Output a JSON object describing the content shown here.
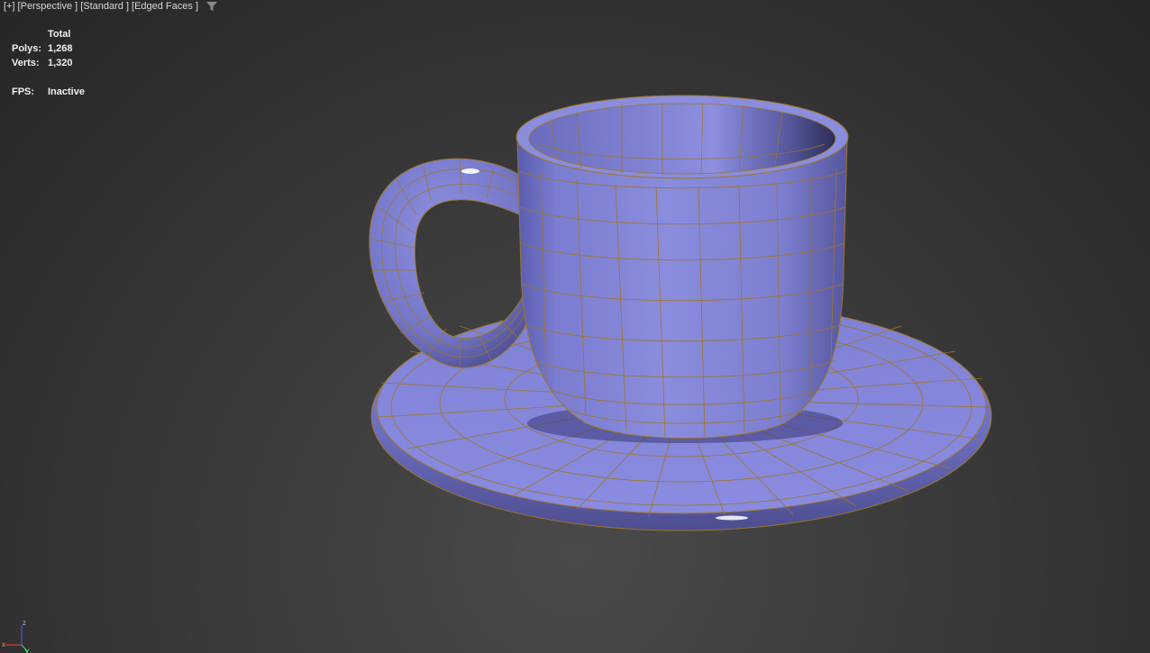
{
  "viewport": {
    "labels": [
      "[+]",
      "[Perspective ]",
      "[Standard ]",
      "[Edged Faces ]"
    ],
    "filter_icon": "funnel-filter-icon"
  },
  "stats": {
    "header": "Total",
    "polys_label": "Polys:",
    "polys_value": "1,268",
    "verts_label": "Verts:",
    "verts_value": "1,320",
    "fps_label": "FPS:",
    "fps_value": "Inactive"
  },
  "scene": {
    "object": "teacup-and-saucer",
    "shading_color": "#8386d6",
    "edge_color": "#b07a1c"
  },
  "axis_gizmo": {
    "z_label": "z",
    "x_label": "x",
    "y_label": "y"
  }
}
